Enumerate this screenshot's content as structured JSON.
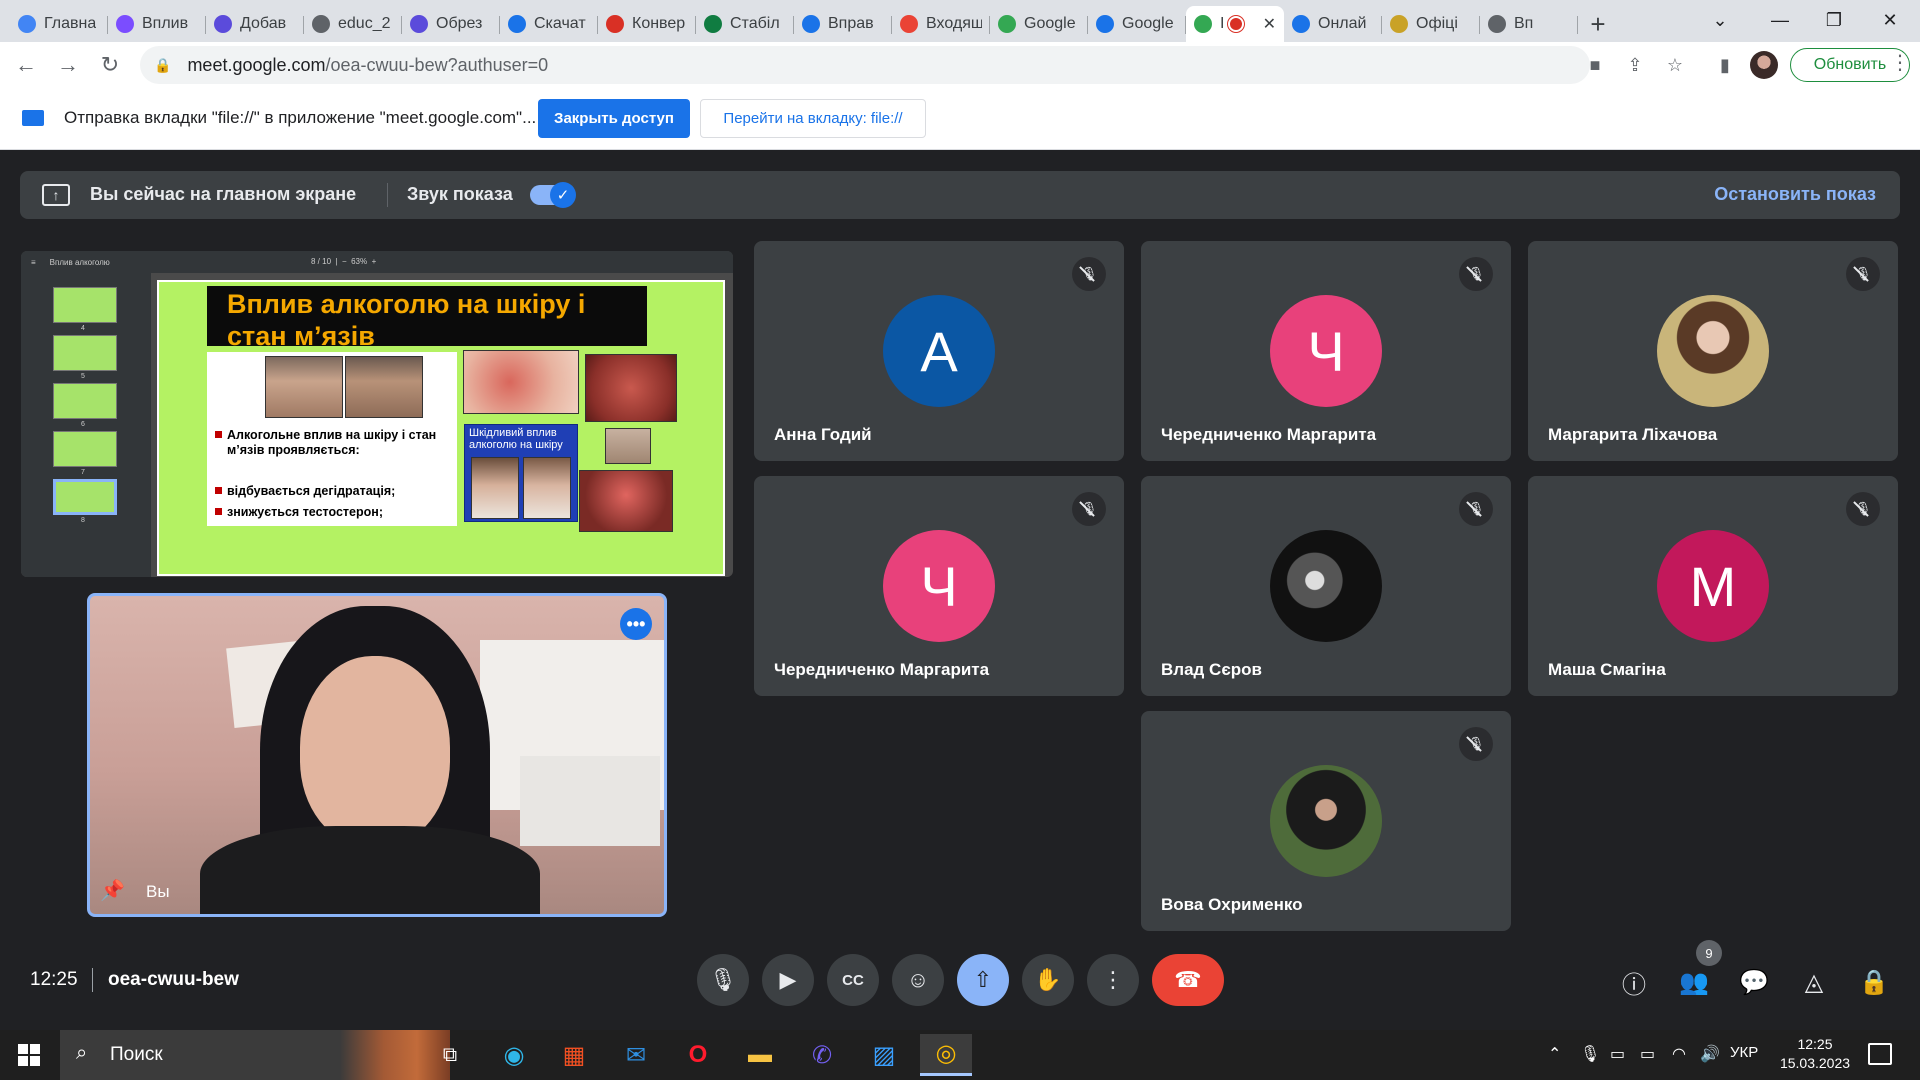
{
  "browser": {
    "tabs": [
      {
        "label": "Главна",
        "fav_color": "#4285f4",
        "fav_icon": "chrome-circle-icon"
      },
      {
        "label": "Вплив",
        "fav_color": "#7b4dff",
        "fav_icon": "shield-icon"
      },
      {
        "label": "Добав",
        "fav_color": "#5b4bdb",
        "fav_icon": "shield-icon"
      },
      {
        "label": "educ_2",
        "fav_color": "#5f6368",
        "fav_icon": "globe-icon"
      },
      {
        "label": "Обрез",
        "fav_color": "#5b4bdb",
        "fav_icon": "shield-icon"
      },
      {
        "label": "Скачат",
        "fav_color": "#1a73e8",
        "fav_icon": "heart-icon"
      },
      {
        "label": "Конвер",
        "fav_color": "#d93025",
        "fav_icon": "heart-icon"
      },
      {
        "label": "Стабіл",
        "fav_color": "#107c41",
        "fav_icon": "sheet-icon"
      },
      {
        "label": "Вправ",
        "fav_color": "#1a73e8",
        "fav_icon": "triangle-icon"
      },
      {
        "label": "Входящ",
        "fav_color": "#ea4335",
        "fav_icon": "gmail-icon"
      },
      {
        "label": "Google",
        "fav_color": "#34a853",
        "fav_icon": "meet-icon"
      },
      {
        "label": "Google",
        "fav_color": "#1a73e8",
        "fav_icon": "calendar-icon"
      }
    ],
    "active_tab": {
      "label": "I",
      "fav_color": "#34a853",
      "fav_icon": "meet-icon"
    },
    "tabs_after": [
      {
        "label": "Онлай",
        "fav_color": "#1a73e8",
        "fav_icon": "circle-icon"
      },
      {
        "label": "Офіці",
        "fav_color": "#c9a227",
        "fav_icon": "crest-icon"
      },
      {
        "label": "Вп",
        "fav_color": "#5f6368",
        "fav_icon": "globe-icon"
      }
    ],
    "url_host": "meet.google.com",
    "url_path": "/oea-cwuu-bew?authuser=0",
    "update_label": "Обновить"
  },
  "sharebar": {
    "message": "Отправка вкладки \"file://\" в приложение \"meet.google.com\"...",
    "stop_access_label": "Закрыть доступ",
    "goto_tab_label": "Перейти на вкладку: file://"
  },
  "presenting": {
    "status": "Вы сейчас на главном экране",
    "sound_label": "Звук показа",
    "sound_on": true,
    "stop_label": "Остановить показ"
  },
  "shared_screen": {
    "doc_title": "Вплив алкоголю",
    "page_info": "8 / 10",
    "zoom": "63%",
    "thumb_numbers": [
      "4",
      "5",
      "6",
      "7",
      "8"
    ],
    "slide": {
      "title": "Вплив алкоголю  на шкіру і стан м’язів",
      "bullets": [
        "Алкогольне вплив на шкіру і стан м’язів проявляється:",
        "відбувається дегідратація;",
        "знижується тестостерон;"
      ],
      "box_caption": "Шкідливий вплив алкоголю на шкіру"
    }
  },
  "self_tile": {
    "name": "Вы"
  },
  "participants": [
    {
      "name": "Анна Годий",
      "initial": "А",
      "avatar_color": "#0b57a4",
      "muted": true,
      "has_photo": false
    },
    {
      "name": "Чередниченко Маргарита",
      "initial": "Ч",
      "avatar_color": "#e8417b",
      "muted": true,
      "has_photo": false
    },
    {
      "name": "Маргарита Ліхачова",
      "initial": "",
      "avatar_color": "#8a7a4a",
      "muted": true,
      "has_photo": true
    },
    {
      "name": "Чередниченко Маргарита",
      "initial": "Ч",
      "avatar_color": "#e8417b",
      "muted": true,
      "has_photo": false
    },
    {
      "name": "Влад Сєров",
      "initial": "",
      "avatar_color": "#222222",
      "muted": true,
      "has_photo": true
    },
    {
      "name": "Маша Смагіна",
      "initial": "М",
      "avatar_color": "#c2185b",
      "muted": true,
      "has_photo": false
    },
    {
      "name": "Вова Охрименко",
      "initial": "",
      "avatar_color": "#3d5a2a",
      "muted": true,
      "has_photo": true
    }
  ],
  "controls": {
    "time": "12:25",
    "meeting_code": "oea-cwuu-bew",
    "participant_count": "9"
  },
  "taskbar": {
    "search_label": "Поиск",
    "language": "УКР",
    "time": "12:25",
    "date": "15.03.2023"
  }
}
